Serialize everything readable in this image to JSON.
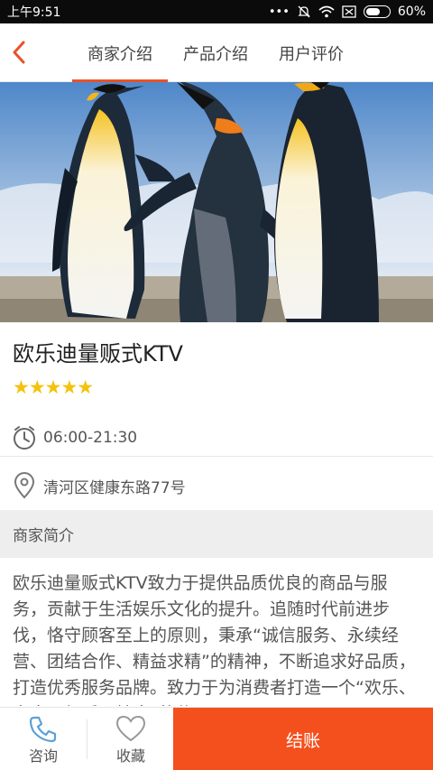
{
  "statusbar": {
    "time": "上午9:51",
    "battery": "60%",
    "icons": [
      "more-dots-icon",
      "mute-icon",
      "wifi-icon",
      "sim-off-icon",
      "battery-icon"
    ]
  },
  "nav": {
    "back_icon": "chevron-left-icon",
    "tabs": [
      {
        "label": "商家介绍",
        "active": true
      },
      {
        "label": "产品介绍",
        "active": false
      },
      {
        "label": "用户评价",
        "active": false
      }
    ],
    "accent": "#e8522a"
  },
  "store": {
    "name": "欧乐迪量贩式KTV",
    "rating": 5,
    "stars_text": "★★★★★",
    "hours": "06:00-21:30",
    "address": "清河区健康东路77号"
  },
  "section": {
    "title": "商家简介"
  },
  "description": "欧乐迪量贩式KTV致力于提供品质优良的商品与服务，贡献于生活娱乐文化的提升。追随时代前进步伐，恪守顾客至上的原则，秉承“诚信服务、永续经营、团结合作、精益求精”的精神，不断追求好品质，打造优秀服务品牌。致力于为消费者打造一个“欢乐、安全、舒适、健康”的休",
  "bottombar": {
    "consult": "咨询",
    "favorite": "收藏",
    "checkout": "结账",
    "checkout_color": "#f4501e"
  }
}
